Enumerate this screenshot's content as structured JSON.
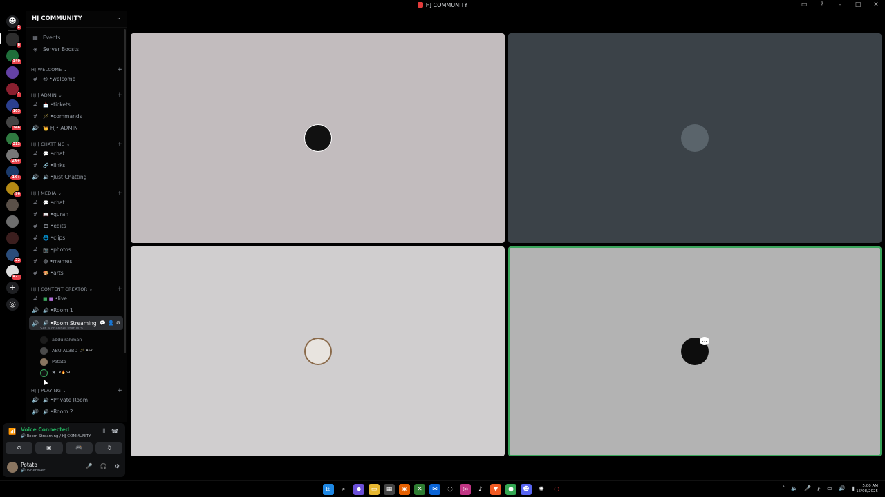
{
  "window": {
    "title": "HJ COMMUNITY"
  },
  "rail_badges": [
    "2",
    "8",
    "340",
    "1",
    "103",
    "346",
    "213",
    "2K+",
    "1K+",
    "96",
    "22",
    "421"
  ],
  "guild": {
    "name": "HJ COMMUNITY"
  },
  "top_links": [
    "Events",
    "Server Boosts"
  ],
  "categories": {
    "welcome": "HJ|WELCOME",
    "admin": "HJ | ADMIN",
    "chatting": "HJ | CHATTING",
    "media": "HJ | MEDIA",
    "creator": "HJ | CONTENT CREATOR",
    "playing": "HJ | PLAYING"
  },
  "channels": {
    "welcome": "•welcome",
    "tickets": "•tickets",
    "commands": "•commands",
    "admin_voice": "HJ• ADMIN",
    "chat": "•chat",
    "links": "•links",
    "just_chatting": "•Just Chatting",
    "media_chat": "•chat",
    "quran": "•quran",
    "edits": "•edits",
    "clips": "•clips",
    "photos": "•photos",
    "memes": "•memes",
    "arts": "•arts",
    "live": "•live",
    "room1": "•Room 1",
    "room_streaming": "•Room Streaming",
    "set_status": "Set a channel status",
    "private_room": "•Private Room",
    "room2": "•Room 2"
  },
  "voice_users": [
    {
      "name": "abdulrahman",
      "tag": ""
    },
    {
      "name": "ABU AL3BD",
      "tag": "AS7"
    },
    {
      "name": "Potato",
      "tag": ""
    },
    {
      "name": "✖",
      "tag": "69"
    }
  ],
  "voice_panel": {
    "title": "Voice Connected",
    "subtitle": "Room Streaming / HJ COMMUNITY"
  },
  "user_panel": {
    "name": "Potato",
    "status": "Wherever"
  },
  "clock": {
    "time": "5:00 AM",
    "date": "15/08/2025"
  },
  "colors": {
    "tile1": "#c2bcbe",
    "tile2": "#3b4248",
    "tile3": "#d0cecf",
    "tile4": "#b3b3b3",
    "speaking": "#3ba55c",
    "connected": "#23a55a"
  }
}
